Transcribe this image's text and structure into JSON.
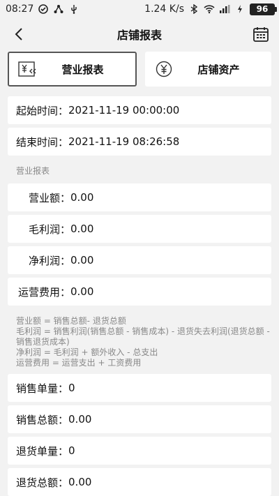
{
  "status_bar": {
    "time": "08:27",
    "speed": "1.24 K/s",
    "battery": "96"
  },
  "nav": {
    "title": "店铺报表",
    "back_icon": "chevron-left-icon",
    "calendar_icon": "calendar-icon"
  },
  "tabs": [
    {
      "label": "营业报表",
      "icon": "report-yen-icon",
      "active": true
    },
    {
      "label": "店铺资产",
      "icon": "yen-circle-icon",
      "active": false
    }
  ],
  "time_range": {
    "start_label": "起始时间：",
    "start_value": "2021-11-19 00:00:00",
    "end_label": "结束时间：",
    "end_value": "2021-11-19 08:26:58"
  },
  "section_title": "营业报表",
  "metrics": [
    {
      "label": "营业额：",
      "value": "0.00"
    },
    {
      "label": "毛利润：",
      "value": "0.00"
    },
    {
      "label": "净利润：",
      "value": "0.00"
    },
    {
      "label": "运营费用：",
      "value": "0.00"
    }
  ],
  "notes": [
    "营业额 = 销售总额- 退货总额",
    "毛利润 = 销售利润(销售总额 - 销售成本) - 退货失去利润(退货总额 - 销售退货成本)",
    "净利润 = 毛利润 + 额外收入 - 总支出",
    "运营费用 = 运营支出 + 工资费用"
  ],
  "sales": [
    {
      "label": "销售单量：",
      "value": "0"
    },
    {
      "label": "销售总额：",
      "value": "0.00"
    },
    {
      "label": "退货单量：",
      "value": "0"
    },
    {
      "label": "退货总额：",
      "value": "0.00"
    }
  ]
}
